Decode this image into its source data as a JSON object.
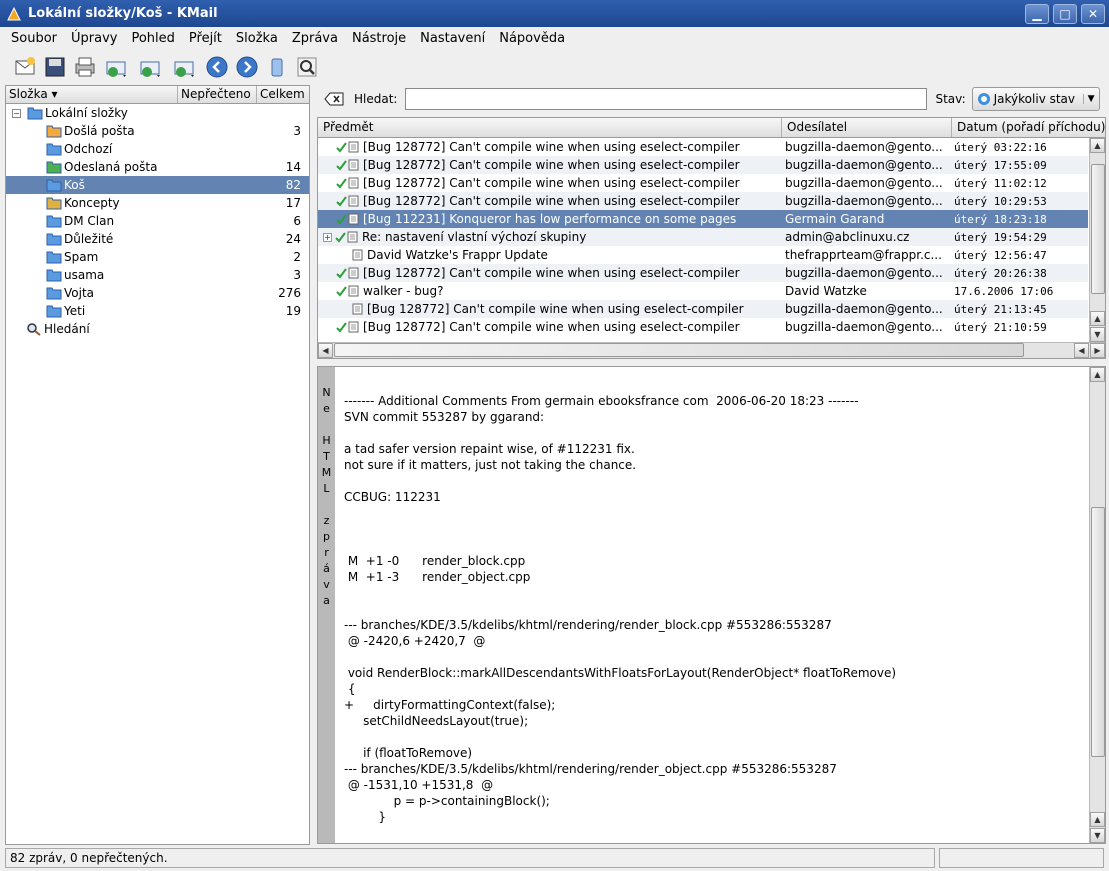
{
  "window": {
    "title": "Lokální složky/Koš - KMail"
  },
  "menu": [
    "Soubor",
    "Úpravy",
    "Pohled",
    "Přejít",
    "Složka",
    "Zpráva",
    "Nástroje",
    "Nastavení",
    "Nápověda"
  ],
  "toolbar": {
    "icons": [
      "new-message-icon",
      "save-icon",
      "print-icon",
      "check-mail-icon",
      "reply-icon",
      "forward-icon",
      "back-icon",
      "forward-nav-icon",
      "trash-icon",
      "find-icon"
    ]
  },
  "folders": {
    "header": {
      "name": "Složka",
      "unread": "Nepřečteno",
      "total": "Celkem"
    },
    "root": "Lokální složky",
    "items": [
      {
        "label": "Došlá pošta",
        "count": "3",
        "icon": "inbox-icon",
        "color": "#f3a93c"
      },
      {
        "label": "Odchozí",
        "count": "",
        "icon": "outbox-icon",
        "color": "#5a9be0"
      },
      {
        "label": "Odeslaná pošta",
        "count": "14",
        "icon": "sent-icon",
        "color": "#4caf50"
      },
      {
        "label": "Koš",
        "count": "82",
        "icon": "trash-folder-icon",
        "color": "#5a9be0"
      },
      {
        "label": "Koncepty",
        "count": "17",
        "icon": "drafts-icon",
        "color": "#e0b040"
      },
      {
        "label": "DM Clan",
        "count": "6",
        "icon": "folder-icon",
        "color": "#5a9be0"
      },
      {
        "label": "Důležité",
        "count": "24",
        "icon": "folder-icon",
        "color": "#5a9be0"
      },
      {
        "label": "Spam",
        "count": "2",
        "icon": "folder-icon",
        "color": "#5a9be0"
      },
      {
        "label": "usama",
        "count": "3",
        "icon": "folder-icon",
        "color": "#5a9be0"
      },
      {
        "label": "Vojta",
        "count": "276",
        "icon": "folder-icon",
        "color": "#5a9be0"
      },
      {
        "label": "Yeti",
        "count": "19",
        "icon": "folder-icon",
        "color": "#5a9be0"
      }
    ],
    "search": "Hledání"
  },
  "search": {
    "label": "Hledat:",
    "value": "",
    "status_label": "Stav:",
    "status_value": "Jakýkoliv stav"
  },
  "messages": {
    "header": {
      "subject": "Předmět",
      "sender": "Odesílatel",
      "date": "Datum (pořadí příchodu)"
    },
    "rows": [
      {
        "subject": "[Bug 128772] Can't compile wine when using eselect-compiler",
        "sender": "bugzilla-daemon@gento...",
        "date": "úterý 03:22:16"
      },
      {
        "subject": "[Bug 128772] Can't compile wine when using eselect-compiler",
        "sender": "bugzilla-daemon@gento...",
        "date": "úterý 17:55:09"
      },
      {
        "subject": "[Bug 128772] Can't compile wine when using eselect-compiler",
        "sender": "bugzilla-daemon@gento...",
        "date": "úterý 11:02:12"
      },
      {
        "subject": "[Bug 128772] Can't compile wine when using eselect-compiler",
        "sender": "bugzilla-daemon@gento...",
        "date": "úterý 10:29:53"
      },
      {
        "subject": "[Bug 112231] Konqueror has low performance on some pages",
        "sender": "Germain Garand",
        "date": "úterý 18:23:18"
      },
      {
        "subject": "Re: nastavení vlastní výchozí skupiny",
        "sender": "admin@abclinuxu.cz",
        "date": "úterý 19:54:29"
      },
      {
        "subject": "David Watzke's Frappr Update",
        "sender": "thefrapprteam@frappr.c...",
        "date": "úterý 12:56:47"
      },
      {
        "subject": "[Bug 128772] Can't compile wine when using eselect-compiler",
        "sender": "bugzilla-daemon@gento...",
        "date": "úterý 20:26:38"
      },
      {
        "subject": "walker - bug?",
        "sender": "David Watzke",
        "date": "17.6.2006 17:06"
      },
      {
        "subject": "[Bug 128772] Can't compile wine when using eselect-compiler",
        "sender": "bugzilla-daemon@gento...",
        "date": "úterý 21:13:45"
      },
      {
        "subject": "[Bug 128772] Can't compile wine when using eselect-compiler",
        "sender": "bugzilla-daemon@gento...",
        "date": "úterý 21:10:59"
      }
    ]
  },
  "reader": {
    "html_strip": [
      "N",
      "e",
      "",
      "H",
      "T",
      "M",
      "L",
      "",
      "z",
      "p",
      "r",
      "á",
      "v",
      "a"
    ],
    "body": "------- Additional Comments From germain ebooksfrance com  2006-06-20 18:23 -------\nSVN commit 553287 by ggarand:\n\na tad safer version repaint wise, of #112231 fix.\nnot sure if it matters, just not taking the chance.\n\nCCBUG: 112231\n\n\n\n M  +1 -0      render_block.cpp\n M  +1 -3      render_object.cpp\n\n\n--- branches/KDE/3.5/kdelibs/khtml/rendering/render_block.cpp #553286:553287\n @ -2420,6 +2420,7  @\n\n void RenderBlock::markAllDescendantsWithFloatsForLayout(RenderObject* floatToRemove)\n {\n+     dirtyFormattingContext(false);\n     setChildNeedsLayout(true);\n\n     if (floatToRemove)\n--- branches/KDE/3.5/kdelibs/khtml/rendering/render_object.cpp #553286:553287\n @ -1531,10 +1531,8  @\n             p = p->containingBlock();\n         }\n\n-        if (outermostBlock) {"
  },
  "status": {
    "text": "82 zpráv, 0 nepřečtených."
  },
  "colors": {
    "selection": "#6384b3",
    "titlebar": "#2f5fae",
    "check": "#2e9e3a"
  }
}
